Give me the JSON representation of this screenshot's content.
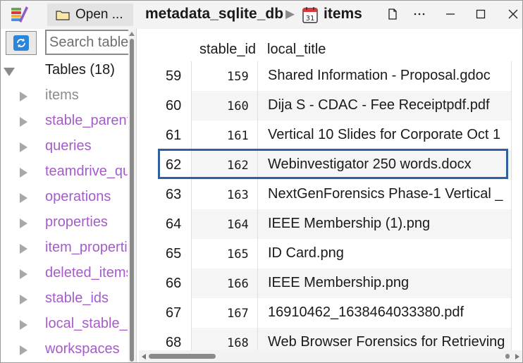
{
  "titlebar": {
    "open_tab_label": "Open ...",
    "database_name": "metadata_sqlite_db",
    "breadcrumb_separator": "▶",
    "table_name": "items",
    "calendar_icon_text": "31",
    "buttons": [
      "new-document-icon",
      "more-icon",
      "minimize-icon",
      "maximize-icon",
      "close-icon"
    ]
  },
  "sidebar": {
    "search_placeholder": "Search tables",
    "tree_root": "Tables (18)",
    "items": [
      {
        "label": "items",
        "state": "selected"
      },
      {
        "label": "stable_parents"
      },
      {
        "label": "queries"
      },
      {
        "label": "teamdrive_quota"
      },
      {
        "label": "operations"
      },
      {
        "label": "properties"
      },
      {
        "label": "item_properties"
      },
      {
        "label": "deleted_items"
      },
      {
        "label": "stable_ids"
      },
      {
        "label": "local_stable_ids"
      },
      {
        "label": "workspaces"
      }
    ]
  },
  "grid": {
    "columns": [
      "stable_id",
      "local_title"
    ],
    "rows": [
      {
        "num": "59",
        "stable_id": "159",
        "local_title": "Shared Information - Proposal.gdoc"
      },
      {
        "num": "60",
        "stable_id": "160",
        "local_title": "Dija S - CDAC - Fee Receiptpdf.pdf"
      },
      {
        "num": "61",
        "stable_id": "161",
        "local_title": "Vertical 10 Slides for Corporate Oct 1"
      },
      {
        "num": "62",
        "stable_id": "162",
        "local_title": "Webinvestigator 250 words.docx"
      },
      {
        "num": "63",
        "stable_id": "163",
        "local_title": "NextGenForensics Phase-1 Vertical _"
      },
      {
        "num": "64",
        "stable_id": "164",
        "local_title": "IEEE Membership (1).png"
      },
      {
        "num": "65",
        "stable_id": "165",
        "local_title": "ID Card.png"
      },
      {
        "num": "66",
        "stable_id": "166",
        "local_title": "IEEE Membership.png"
      },
      {
        "num": "67",
        "stable_id": "167",
        "local_title": "16910462_1638464033380.pdf"
      },
      {
        "num": "68",
        "stable_id": "168",
        "local_title": "Web Browser Forensics for Retrieving"
      }
    ],
    "highlighted_row": "62"
  },
  "colors": {
    "accent": "#2f5f9e",
    "tree_link": "#a35cc9",
    "refresh_button": "#2b86d9"
  }
}
